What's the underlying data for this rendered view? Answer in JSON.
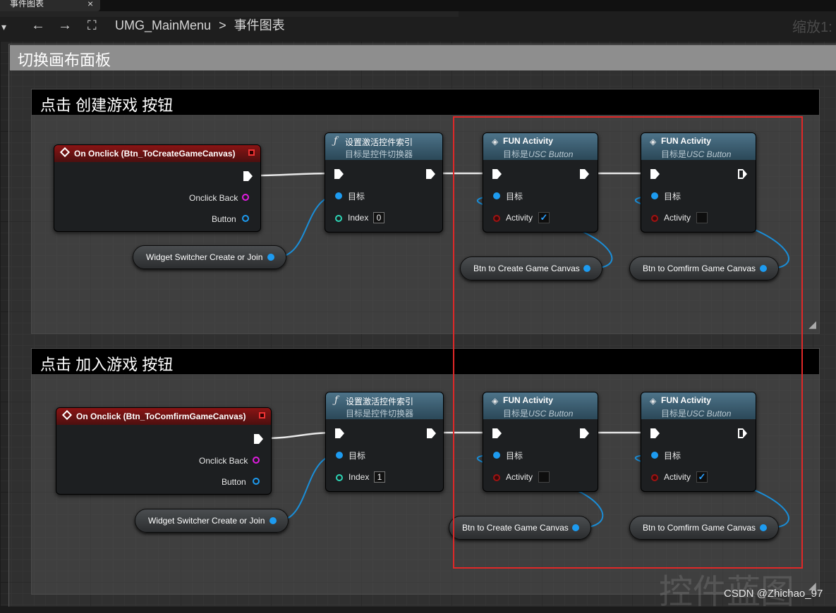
{
  "tab": {
    "title": "事件图表",
    "close": "×"
  },
  "toolbar": {
    "breadcrumb": [
      "UMG_MainMenu",
      ">",
      "事件图表"
    ],
    "zoom": "缩放1:"
  },
  "outer_comment": {
    "title": "切换画布面板"
  },
  "sections": [
    {
      "title": "点击 创建游戏 按钮",
      "event": {
        "title": "On Onclick (Btn_ToCreateGameCanvas)",
        "pins": [
          "Onclick Back",
          "Button"
        ]
      },
      "switcher_var": "Widget Switcher Create or Join",
      "set_index": {
        "title": "设置激活控件索引",
        "subtitle": "目标是控件切换器",
        "target": "目标",
        "index_label": "Index",
        "index_value": "0"
      },
      "fun1": {
        "title": "FUN Activity",
        "subtitle_prefix": "目标是",
        "subtitle_class": "USC Button",
        "target": "目标",
        "activity": "Activity",
        "checked": true
      },
      "fun2": {
        "title": "FUN Activity",
        "subtitle_prefix": "目标是",
        "subtitle_class": "USC Button",
        "target": "目标",
        "activity": "Activity",
        "checked": false
      },
      "var1": "Btn to Create Game Canvas",
      "var2": "Btn to Comfirm Game Canvas"
    },
    {
      "title": "点击 加入游戏 按钮",
      "event": {
        "title": "On Onclick (Btn_ToComfirmGameCanvas)",
        "pins": [
          "Onclick Back",
          "Button"
        ]
      },
      "switcher_var": "Widget Switcher Create or Join",
      "set_index": {
        "title": "设置激活控件索引",
        "subtitle": "目标是控件切换器",
        "target": "目标",
        "index_label": "Index",
        "index_value": "1"
      },
      "fun1": {
        "title": "FUN Activity",
        "subtitle_prefix": "目标是",
        "subtitle_class": "USC Button",
        "target": "目标",
        "activity": "Activity",
        "checked": false
      },
      "fun2": {
        "title": "FUN Activity",
        "subtitle_prefix": "目标是",
        "subtitle_class": "USC Button",
        "target": "目标",
        "activity": "Activity",
        "checked": true
      },
      "var1": "Btn to Create Game Canvas",
      "var2": "Btn to Comfirm Game Canvas"
    }
  ],
  "watermark": "控件蓝图",
  "credit": "CSDN @Zhichao_97",
  "colors": {
    "exec": "#ffffff",
    "object_pin": "#1d9bf0",
    "event_head": "#8a1414",
    "function_head": "#4d7389",
    "highlight": "#e02828",
    "bool_pin": "#a01212",
    "int_pin": "#2dd5b5",
    "delegate_pin": "#e11ce1"
  }
}
